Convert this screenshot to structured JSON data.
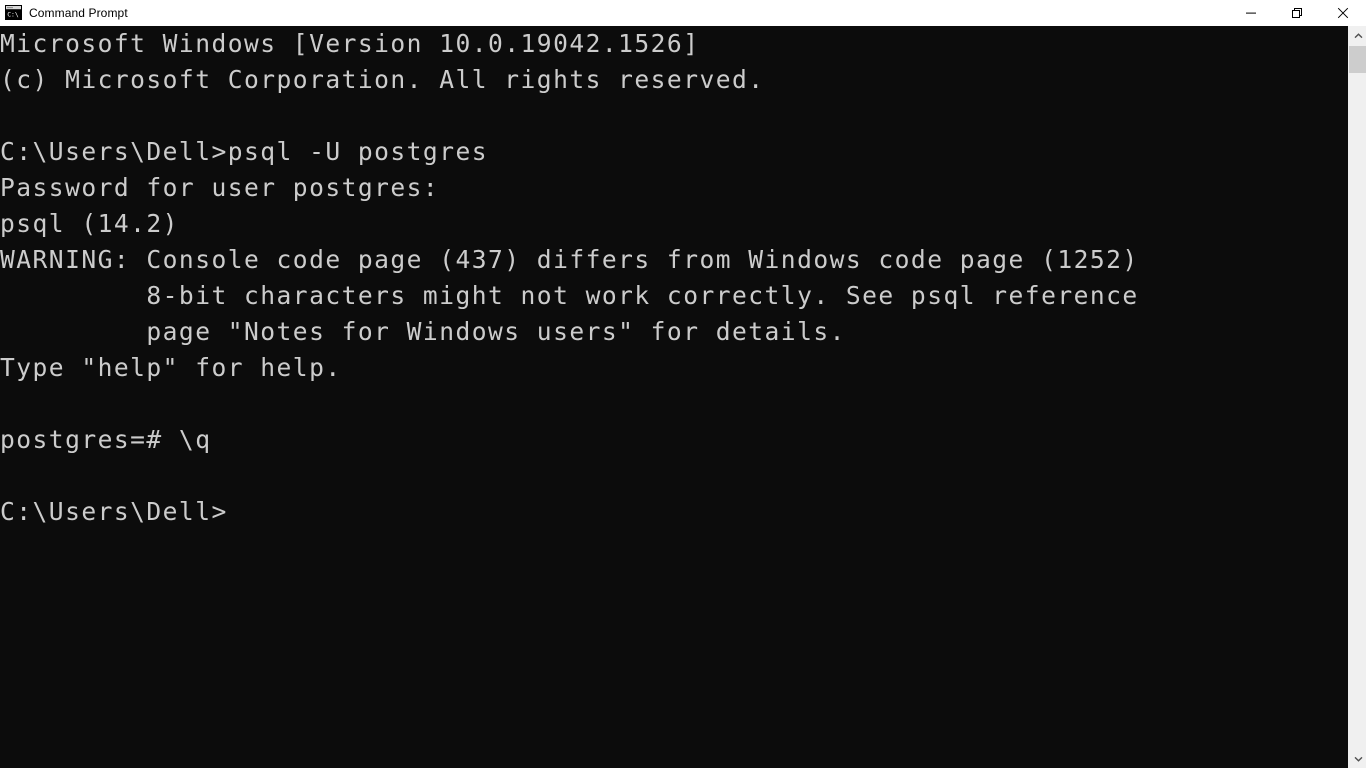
{
  "window": {
    "title": "Command Prompt",
    "icon": "cmd-prompt-icon",
    "controls": {
      "minimize_label": "Minimize",
      "maximize_label": "Restore",
      "close_label": "Close"
    }
  },
  "colors": {
    "titlebar_background": "#ffffff",
    "titlebar_text": "#000000",
    "console_background": "#0c0c0c",
    "console_text": "#cccccc",
    "scrollbar_track": "#f0f0f0",
    "scrollbar_thumb": "#cdcdcd"
  },
  "console": {
    "lines": [
      "Microsoft Windows [Version 10.0.19042.1526]",
      "(c) Microsoft Corporation. All rights reserved.",
      "",
      "C:\\Users\\Dell>psql -U postgres",
      "Password for user postgres:",
      "psql (14.2)",
      "WARNING: Console code page (437) differs from Windows code page (1252)",
      "         8-bit characters might not work correctly. See psql reference",
      "         page \"Notes for Windows users\" for details.",
      "Type \"help\" for help.",
      "",
      "postgres=# \\q",
      "",
      "C:\\Users\\Dell>"
    ],
    "text": "Microsoft Windows [Version 10.0.19042.1526]\n(c) Microsoft Corporation. All rights reserved.\n\nC:\\Users\\Dell>psql -U postgres\nPassword for user postgres:\npsql (14.2)\nWARNING: Console code page (437) differs from Windows code page (1252)\n         8-bit characters might not work correctly. See psql reference\n         page \"Notes for Windows users\" for details.\nType \"help\" for help.\n\npostgres=# \\q\n\nC:\\Users\\Dell>",
    "prompt_current": "C:\\Users\\Dell>",
    "shell_version": "10.0.19042.1526",
    "psql_version": "14.2",
    "console_code_page": "437",
    "windows_code_page": "1252"
  },
  "scrollbar": {
    "up_arrow": "chevron-up-icon",
    "down_arrow": "chevron-down-icon",
    "thumb_position_percent": 0
  }
}
